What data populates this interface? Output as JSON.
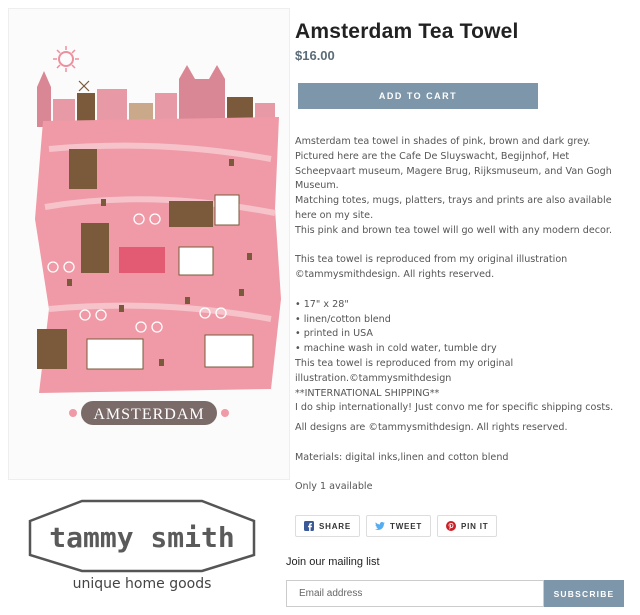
{
  "product": {
    "title": "Amsterdam Tea Towel",
    "price": "$16.00",
    "add_to_cart": "ADD TO CART",
    "image_banner": "AMSTERDAM",
    "description_lines": [
      "Amsterdam tea towel in shades of pink, brown and dark grey.",
      "Pictured here are the Cafe De Sluyswacht, Begijnhof, Het",
      "Scheepvaart museum, Magere Brug, Rijksmuseum, and Van Gogh",
      "Museum.",
      "Matching totes, mugs, platters, trays and prints are also available",
      "here on my site.",
      "This pink and brown tea towel will go well with any modern decor.",
      "",
      "This tea towel is reproduced from my original illustration",
      "©tammysmithdesign. All rights reserved.",
      "",
      "• 17\" x 28\"",
      "• linen/cotton blend",
      "• printed in USA",
      "• machine wash in cold water, tumble dry",
      "This tea towel is reproduced from my original",
      "illustration.©tammysmithdesign",
      "**INTERNATIONAL SHIPPING**",
      "I do ship internationally! Just convo me for specific shipping costs."
    ],
    "rights": "All designs are ©tammysmithdesign. All rights reserved.",
    "materials": "Materials: digital inks,linen and cotton blend",
    "stock": "Only 1 available"
  },
  "share": {
    "facebook": "SHARE",
    "twitter": "TWEET",
    "pinterest": "PIN IT"
  },
  "logo": {
    "name": "tammy smith",
    "tagline": "unique home goods"
  },
  "mailing": {
    "heading": "Join our mailing list",
    "placeholder": "Email address",
    "button": "SUBSCRIBE"
  },
  "colors": {
    "accent": "#7e96a9",
    "pink": "#ef9aa6",
    "brown": "#7a5a3a"
  }
}
